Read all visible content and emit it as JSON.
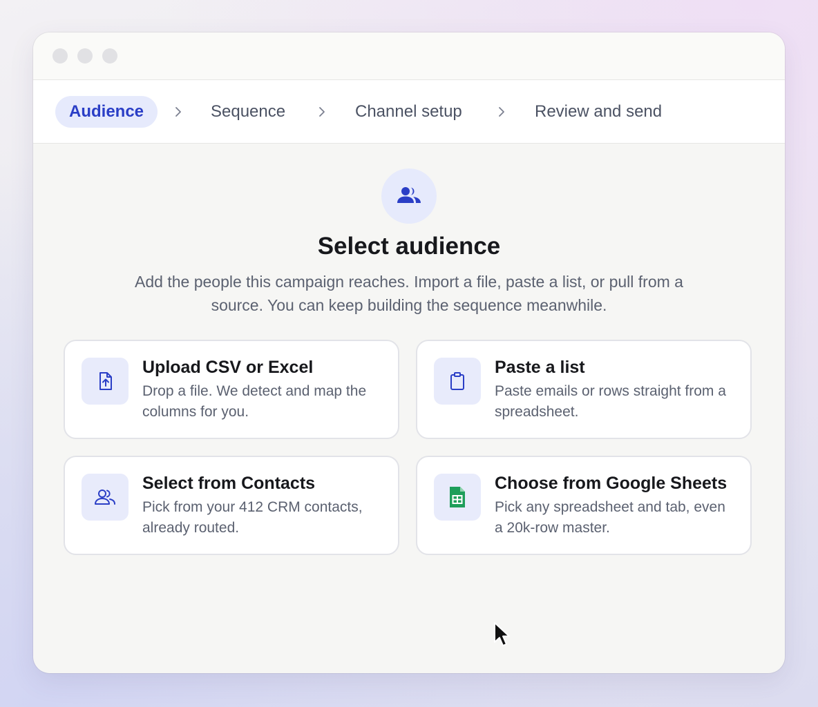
{
  "stepper": {
    "steps": [
      {
        "label": "Audience",
        "active": true
      },
      {
        "label": "Sequence",
        "active": false
      },
      {
        "label": "Channel setup",
        "active": false
      },
      {
        "label": "Review and send",
        "active": false
      }
    ]
  },
  "main": {
    "icon": "people-icon",
    "title": "Select audience",
    "subtitle": "Add the people this campaign reaches. Import a file, paste a list, or pull from a source. You can keep building the sequence meanwhile."
  },
  "options": [
    {
      "title": "Upload CSV or Excel",
      "description": "Drop a file. We detect and map the columns for you.",
      "icon": "file-upload-icon"
    },
    {
      "title": "Paste a list",
      "description": "Paste emails or rows straight from a spreadsheet.",
      "icon": "clipboard-icon"
    },
    {
      "title": "Select from Contacts",
      "description": "Pick from your 412 CRM contacts, already routed.",
      "icon": "contacts-icon"
    },
    {
      "title": "Choose from Google Sheets",
      "description": "Pick any spreadsheet and tab, even a 20k-row master.",
      "icon": "google-sheets-icon"
    }
  ],
  "colors": {
    "accent": "#2a3ec6",
    "accent_soft": "#e6eafc",
    "sheets_green": "#1e9e5a"
  }
}
